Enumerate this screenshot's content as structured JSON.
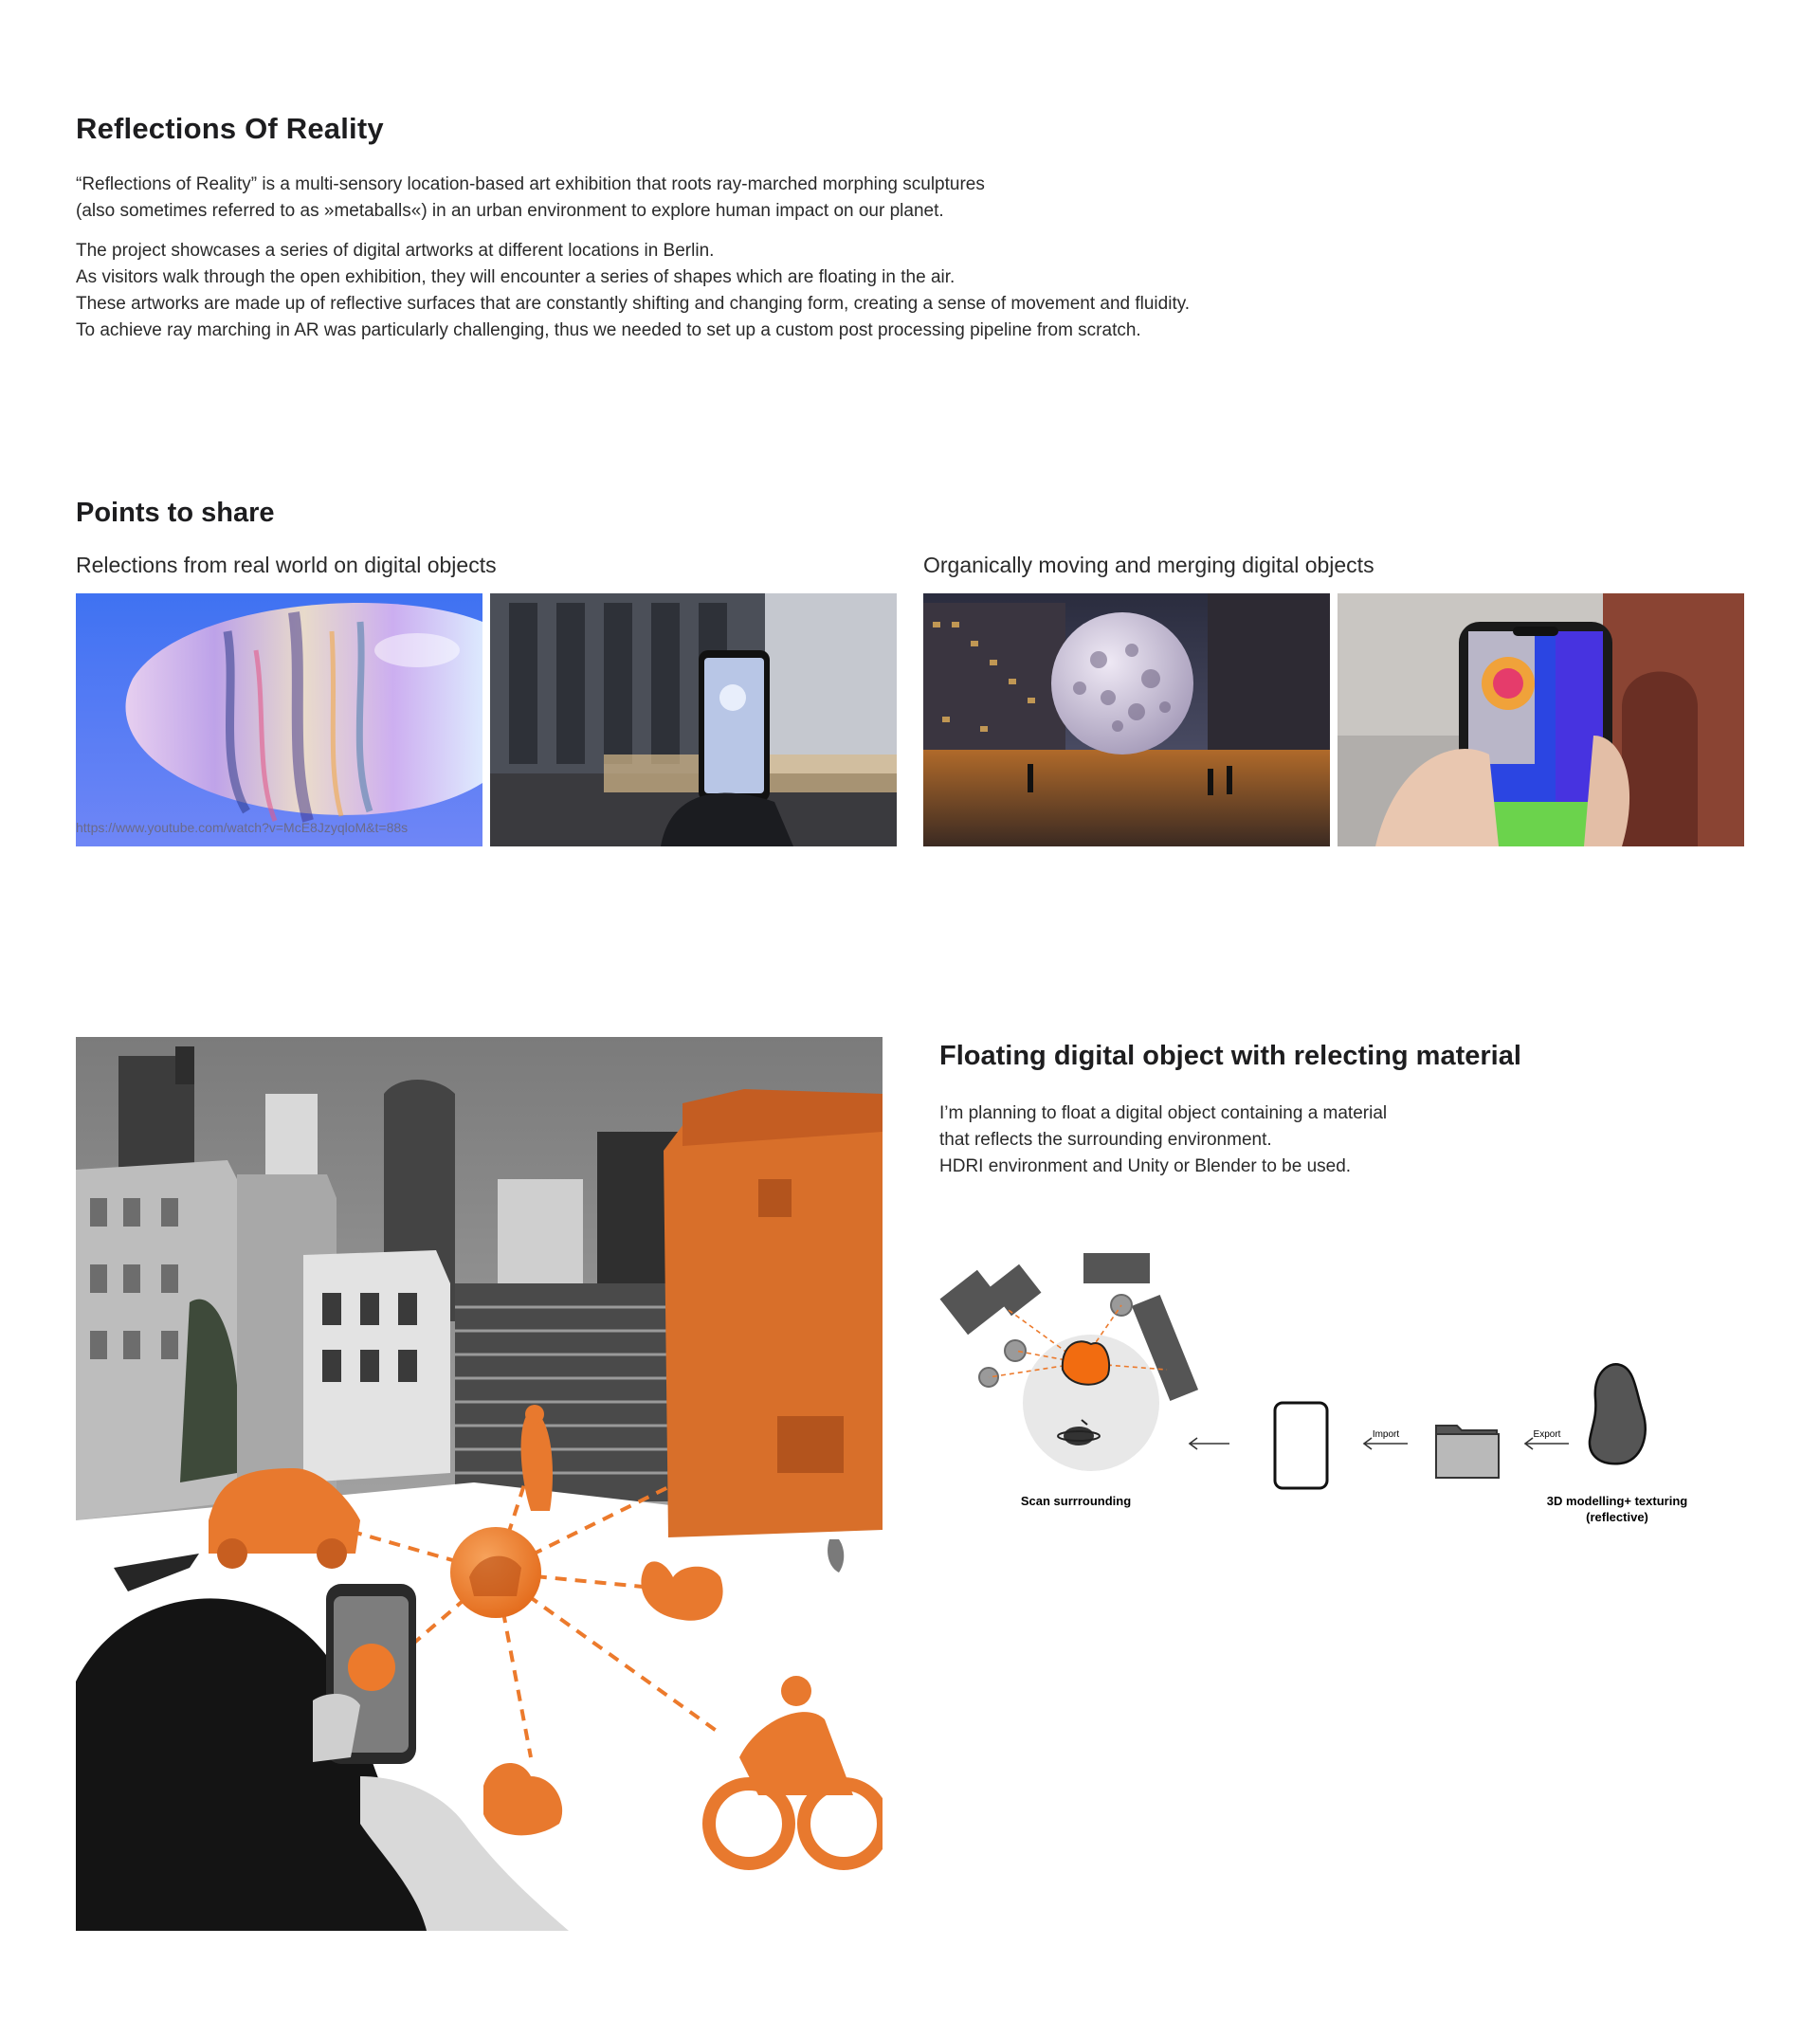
{
  "header": {
    "title": "Reflections Of Reality",
    "intro_lines": [
      "“Reflections of Reality” is a multi-sensory location-based art exhibition that roots ray-marched morphing sculptures",
      "(also sometimes referred to as »metaballs«) in an urban environment to explore human impact on our planet."
    ],
    "body_lines": [
      "The project showcases a series of digital artworks at different locations in Berlin.",
      "As visitors walk through the open exhibition, they will encounter a series of shapes which are floating in the air.",
      "These artworks are made up of reflective surfaces that are constantly shifting and changing form, creating a sense of movement and fluidity.",
      "To achieve ray marching in AR was particularly challenging, thus we needed to set up a custom post processing pipeline from scratch."
    ]
  },
  "points": {
    "title": "Points to share",
    "left_subtitle": "Relections from real world on digital objects",
    "right_subtitle": "Organically moving and merging digital objects",
    "video_url": "https://www.youtube.com/watch?v=McE8JzyqloM&t=88s"
  },
  "floating": {
    "title": "Floating digital object with relecting material",
    "lines": [
      "I’m planning to float a digital object containing a material",
      "that reflects the surrounding environment.",
      "HDRI environment and Unity or Blender to be used."
    ]
  },
  "diagram": {
    "scan_label": "Scan surrrounding",
    "import_label": "Import",
    "export_label": "Export",
    "modelling_label_1": "3D modelling+ texturing",
    "modelling_label_2": "(reflective)"
  },
  "colors": {
    "accent_orange": "#ec7a2c",
    "text": "#1d1d1f",
    "muted": "#2a2a2a"
  }
}
